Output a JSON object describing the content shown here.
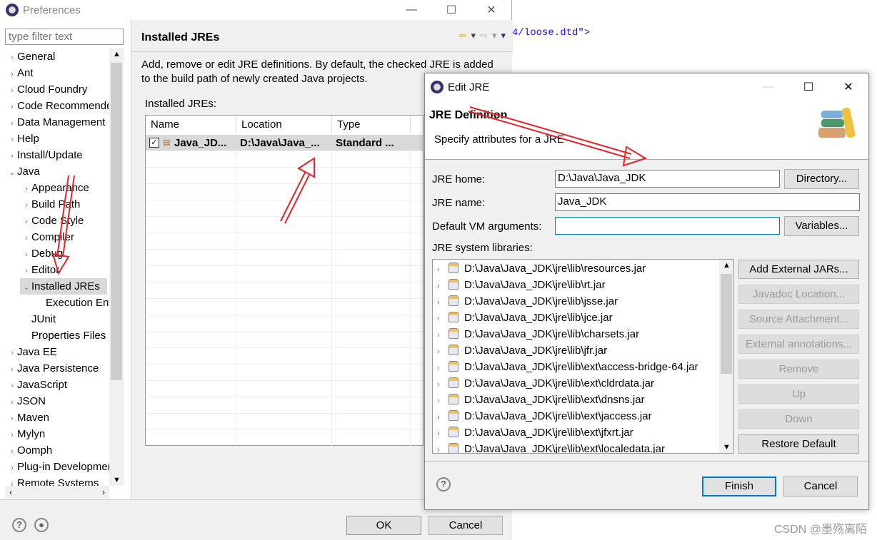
{
  "background": {
    "editor_text": "4/loose.dtd\">",
    "watermark": "CSDN @墨殇离陌"
  },
  "prefs": {
    "title": "Preferences",
    "filter_placeholder": "type filter text",
    "tree": [
      {
        "label": "General",
        "level": 0,
        "expanded": false
      },
      {
        "label": "Ant",
        "level": 0,
        "expanded": false
      },
      {
        "label": "Cloud Foundry",
        "level": 0,
        "expanded": false
      },
      {
        "label": "Code Recommenders",
        "level": 0,
        "expanded": false
      },
      {
        "label": "Data Management",
        "level": 0,
        "expanded": false
      },
      {
        "label": "Help",
        "level": 0,
        "expanded": false
      },
      {
        "label": "Install/Update",
        "level": 0,
        "expanded": false
      },
      {
        "label": "Java",
        "level": 0,
        "expanded": true
      },
      {
        "label": "Appearance",
        "level": 1,
        "expanded": false
      },
      {
        "label": "Build Path",
        "level": 1,
        "expanded": false
      },
      {
        "label": "Code Style",
        "level": 1,
        "expanded": false
      },
      {
        "label": "Compiler",
        "level": 1,
        "expanded": false
      },
      {
        "label": "Debug",
        "level": 1,
        "expanded": false
      },
      {
        "label": "Editor",
        "level": 1,
        "expanded": false
      },
      {
        "label": "Installed JREs",
        "level": 1,
        "expanded": true,
        "selected": true
      },
      {
        "label": "Execution Environments",
        "level": 2,
        "leaf": true
      },
      {
        "label": "JUnit",
        "level": 1,
        "leaf": true
      },
      {
        "label": "Properties Files Editor",
        "level": 1,
        "leaf": true
      },
      {
        "label": "Java EE",
        "level": 0,
        "expanded": false
      },
      {
        "label": "Java Persistence",
        "level": 0,
        "expanded": false
      },
      {
        "label": "JavaScript",
        "level": 0,
        "expanded": false
      },
      {
        "label": "JSON",
        "level": 0,
        "expanded": false
      },
      {
        "label": "Maven",
        "level": 0,
        "expanded": false
      },
      {
        "label": "Mylyn",
        "level": 0,
        "expanded": false
      },
      {
        "label": "Oomph",
        "level": 0,
        "expanded": false
      },
      {
        "label": "Plug-in Development",
        "level": 0,
        "expanded": false
      },
      {
        "label": "Remote Systems",
        "level": 0,
        "expanded": false
      }
    ],
    "page_title": "Installed JREs",
    "description": "Add, remove or edit JRE definitions. By default, the checked JRE is added to the build path of newly created Java projects.",
    "table_label": "Installed JREs:",
    "columns": [
      "Name",
      "Location",
      "Type"
    ],
    "rows": [
      {
        "checked": true,
        "name": "Java_JD...",
        "location": "D:\\Java\\Java_...",
        "type": "Standard ..."
      }
    ],
    "ok": "OK",
    "cancel": "Cancel"
  },
  "edit": {
    "title": "Edit JRE",
    "header_title": "JRE Definition",
    "header_desc": "Specify attributes for a JRE",
    "jre_home_label": "JRE home:",
    "jre_home": "D:\\Java\\Java_JDK",
    "jre_name_label": "JRE name:",
    "jre_name": "Java_JDK",
    "vm_args_label": "Default VM arguments:",
    "vm_args": "",
    "directory": "Directory...",
    "variables": "Variables...",
    "libs_label": "JRE system libraries:",
    "libs": [
      "D:\\Java\\Java_JDK\\jre\\lib\\resources.jar",
      "D:\\Java\\Java_JDK\\jre\\lib\\rt.jar",
      "D:\\Java\\Java_JDK\\jre\\lib\\jsse.jar",
      "D:\\Java\\Java_JDK\\jre\\lib\\jce.jar",
      "D:\\Java\\Java_JDK\\jre\\lib\\charsets.jar",
      "D:\\Java\\Java_JDK\\jre\\lib\\jfr.jar",
      "D:\\Java\\Java_JDK\\jre\\lib\\ext\\access-bridge-64.jar",
      "D:\\Java\\Java_JDK\\jre\\lib\\ext\\cldrdata.jar",
      "D:\\Java\\Java_JDK\\jre\\lib\\ext\\dnsns.jar",
      "D:\\Java\\Java_JDK\\jre\\lib\\ext\\jaccess.jar",
      "D:\\Java\\Java_JDK\\jre\\lib\\ext\\jfxrt.jar",
      "D:\\Java\\Java_JDK\\jre\\lib\\ext\\localedata.jar"
    ],
    "side_buttons": [
      {
        "label": "Add External JARs...",
        "enabled": true
      },
      {
        "label": "Javadoc Location...",
        "enabled": false
      },
      {
        "label": "Source Attachment...",
        "enabled": false
      },
      {
        "label": "External annotations...",
        "enabled": false
      },
      {
        "label": "Remove",
        "enabled": false
      },
      {
        "label": "Up",
        "enabled": false
      },
      {
        "label": "Down",
        "enabled": false
      },
      {
        "label": "Restore Default",
        "enabled": true
      }
    ],
    "finish": "Finish",
    "cancel": "Cancel"
  },
  "colors": {
    "annotation_arrow": "#e8232a",
    "default_button_border": "#0078d7"
  }
}
